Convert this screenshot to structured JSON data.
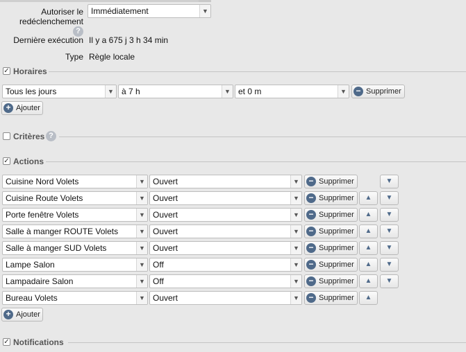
{
  "rule": {
    "retrigger_label": "Autoriser le redéclenchement",
    "retrigger_value": "Immédiatement",
    "last_run_label": "Dernière exécution",
    "last_run_value": "Il y a 675 j 3 h 34 min",
    "type_label": "Type",
    "type_value": "Règle locale",
    "help_glyph": "?"
  },
  "horaires": {
    "title": "Horaires",
    "checked": true,
    "day": "Tous les jours",
    "hour": "à 7 h",
    "minute": "et 0 m",
    "delete_label": "Supprimer",
    "add_label": "Ajouter"
  },
  "criteres": {
    "title": "Critères",
    "checked": false
  },
  "actions": {
    "title": "Actions",
    "checked": true,
    "delete_label": "Supprimer",
    "add_label": "Ajouter",
    "rows": [
      {
        "device": "Cuisine Nord Volets",
        "state": "Ouvert"
      },
      {
        "device": "Cuisine Route Volets",
        "state": "Ouvert"
      },
      {
        "device": "Porte fenêtre Volets",
        "state": "Ouvert"
      },
      {
        "device": "Salle à manger ROUTE Volets",
        "state": "Ouvert"
      },
      {
        "device": "Salle à manger SUD Volets",
        "state": "Ouvert"
      },
      {
        "device": "Lampe Salon",
        "state": "Off"
      },
      {
        "device": "Lampadaire Salon",
        "state": "Off"
      },
      {
        "device": "Bureau Volets",
        "state": "Ouvert"
      }
    ]
  },
  "notifications": {
    "title": "Notifications",
    "checked": true
  },
  "icons": {
    "dropdown": "chevron-down-icon",
    "minus": "minus-circle-icon",
    "plus": "plus-circle-icon",
    "up": "arrow-up-icon",
    "down": "arrow-down-icon"
  },
  "colors": {
    "background": "#e8e8e8",
    "icon": "#4f6a8a",
    "section_title": "#555555"
  }
}
